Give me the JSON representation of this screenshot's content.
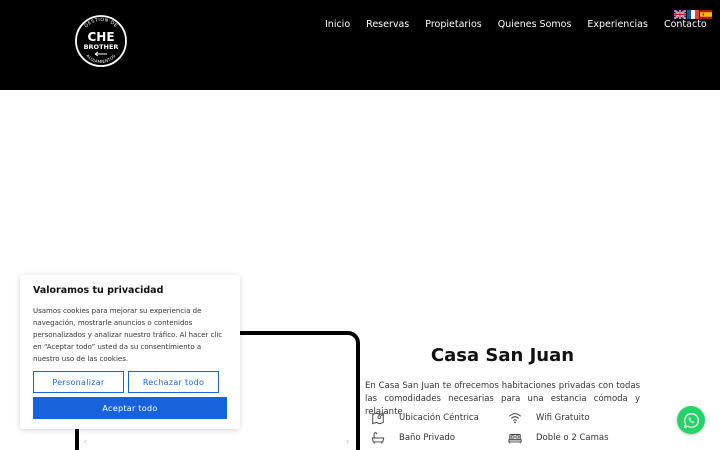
{
  "header": {
    "logo": {
      "top_text": "GESTION DE",
      "line1": "CHE",
      "line2": "BROTHER",
      "bottom_text": "ALOJAMIENTOS"
    },
    "nav": [
      "Inicio",
      "Reservas",
      "Propietarios",
      "Quienes Somos",
      "Experiencias",
      "Contacto"
    ],
    "flags": [
      "english-flag-icon",
      "french-flag-icon",
      "spanish-flag-icon"
    ]
  },
  "property": {
    "title": "Casa San Juan",
    "description": "En Casa San Juan te ofrecemos habitaciones privadas con todas las comodidades necesarias para una estancia cómoda y relajante.",
    "amenities": [
      {
        "label": "Ubicación Céntrica",
        "icon": "map-icon"
      },
      {
        "label": "Wifi Gratuito",
        "icon": "wifi-icon"
      },
      {
        "label": "Baño Privado",
        "icon": "bathtub-icon"
      },
      {
        "label": "Doble o 2 Camas",
        "icon": "bed-icon"
      }
    ]
  },
  "cookie_banner": {
    "title": "Valoramos tu privacidad",
    "text": "Usamos cookies para mejorar su experiencia de navegación, mostrarle anuncios o contenidos personalizados y analizar nuestro tráfico. Al hacer clic en “Aceptar todo” usted da su consentimiento a nuestro uso de las cookies.",
    "customize_label": "Personalizar",
    "reject_label": "Rechazar todo",
    "accept_label": "Aceptar todo",
    "accent_color": "#1863dc"
  },
  "whatsapp": {
    "icon": "whatsapp-icon",
    "color": "#25d366"
  }
}
